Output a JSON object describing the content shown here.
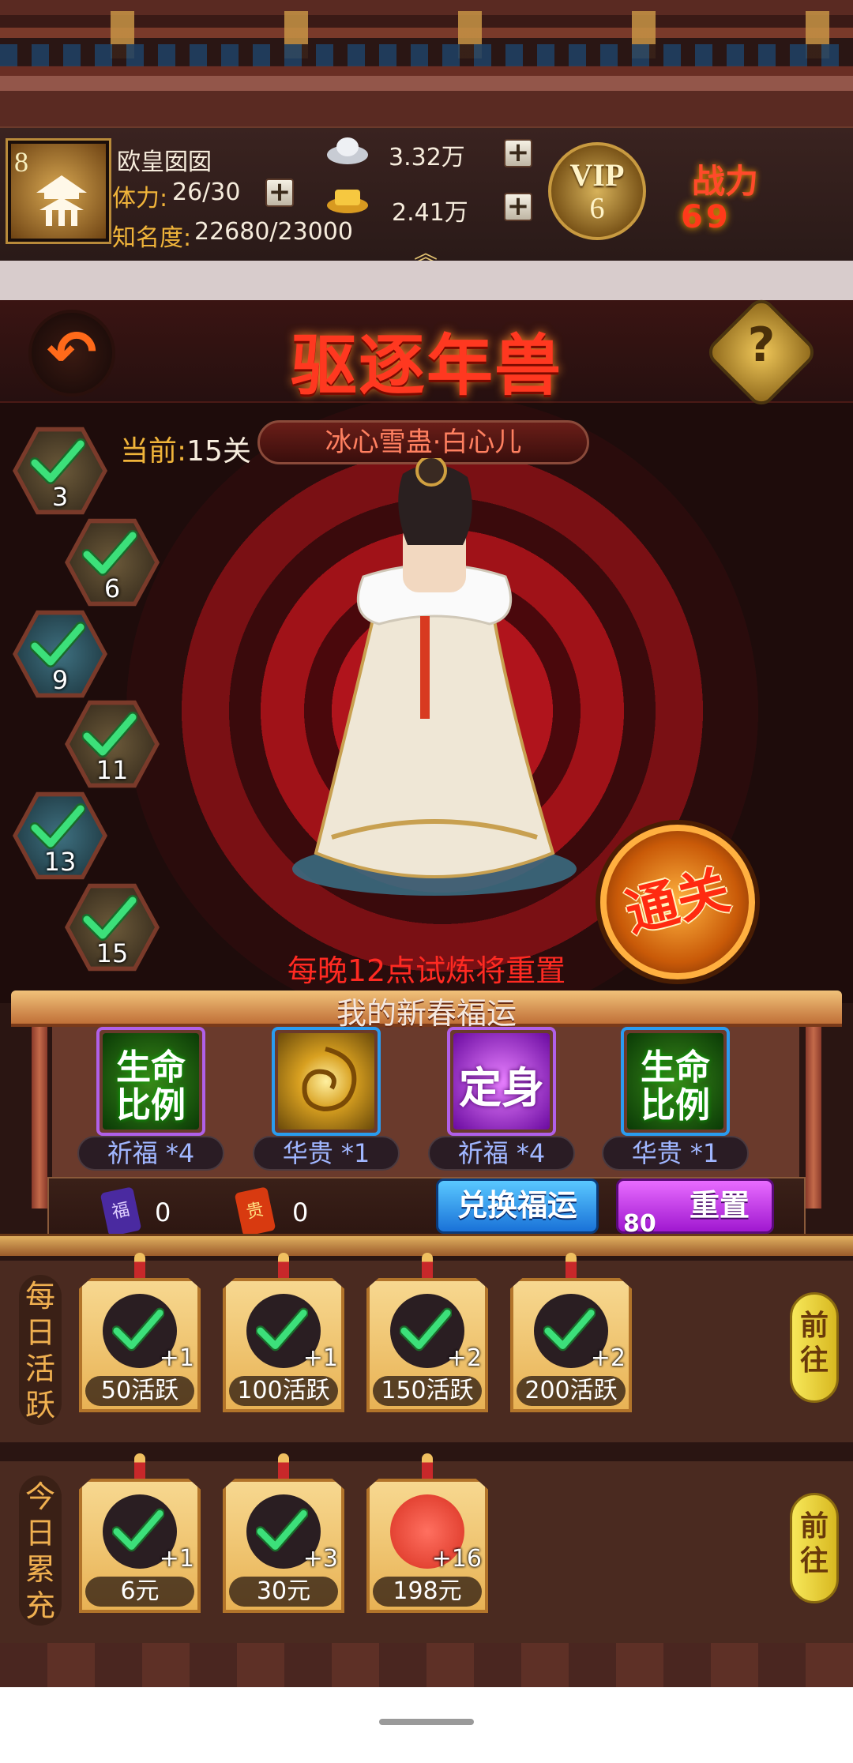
{
  "header": {
    "player_level": "8",
    "player_name": "欧皇囡囡",
    "stamina_label": "体力:",
    "stamina_value": "26/30",
    "fame_label": "知名度:",
    "fame_value": "22680/23000",
    "silver": "3.32万",
    "gold": "2.41万",
    "vip_label": "VIP",
    "vip_level": "6",
    "power_label": "战力",
    "power_value": "69",
    "plus_symbol": "+",
    "expand_symbol": "︽"
  },
  "stage": {
    "title": "驱逐年兽",
    "current_label": "当前:",
    "current_value": "15关",
    "boss_name": "冰心雪蛊·白心儿",
    "clear_button": "通关",
    "reset_notice": "每晚12点试炼将重置",
    "back_symbol": "↶",
    "help_symbol": "?",
    "nodes": [
      {
        "num": "3",
        "style": "bronze"
      },
      {
        "num": "6",
        "style": "bronze"
      },
      {
        "num": "9",
        "style": "teal"
      },
      {
        "num": "11",
        "style": "bronze"
      },
      {
        "num": "13",
        "style": "teal"
      },
      {
        "num": "15",
        "style": "bronze"
      }
    ]
  },
  "fortune": {
    "title": "我的新春福运",
    "cards": [
      {
        "art_text": "生命\n比例",
        "caption": "祈福 *4",
        "frame": "purple"
      },
      {
        "art_text": "",
        "caption": "华贵 *1",
        "frame": "blue"
      },
      {
        "art_text": "定身",
        "caption": "祈福 *4",
        "frame": "purple"
      },
      {
        "art_text": "生命\n比例",
        "caption": "华贵 *1",
        "frame": "blue"
      }
    ],
    "fu_token": "福",
    "fu_count": "0",
    "gui_token": "贵",
    "gui_count": "0",
    "exchange_button": "兑换福运",
    "reset_cost": "80",
    "reset_button": "重置"
  },
  "daily_activity": {
    "label": "每日活跃",
    "go_button": "前往",
    "rewards": [
      {
        "qty": "+1",
        "requirement": "50活跃"
      },
      {
        "qty": "+1",
        "requirement": "100活跃"
      },
      {
        "qty": "+2",
        "requirement": "150活跃"
      },
      {
        "qty": "+2",
        "requirement": "200活跃"
      }
    ]
  },
  "daily_recharge": {
    "label": "今日累充",
    "go_button": "前往",
    "rewards": [
      {
        "qty": "+1",
        "requirement": "6元",
        "claimed": true
      },
      {
        "qty": "+3",
        "requirement": "30元",
        "claimed": true
      },
      {
        "qty": "+16",
        "requirement": "198元",
        "claimed": false
      }
    ]
  },
  "colors": {
    "accent_gold": "#f0b43a",
    "title_red": "#ff3820",
    "check_green": "#3ce07a"
  }
}
